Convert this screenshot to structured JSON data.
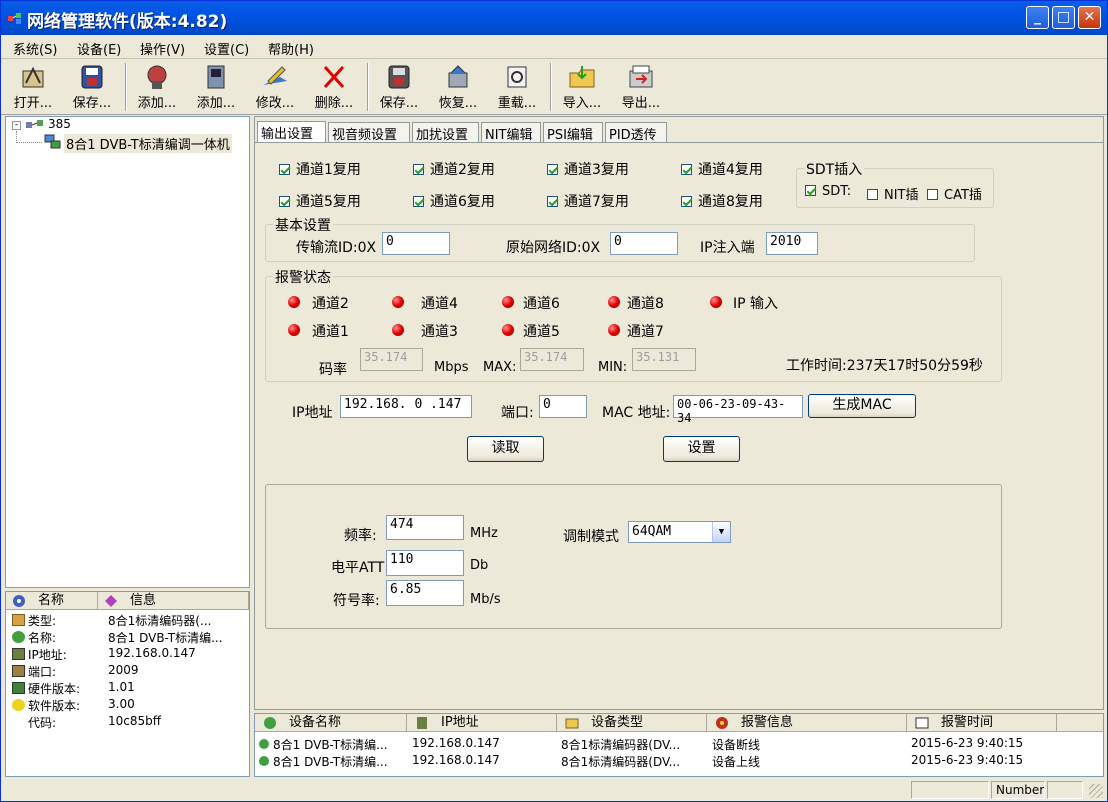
{
  "window": {
    "title": "网络管理软件(版本:4.82)"
  },
  "menu": [
    "系统(S)",
    "设备(E)",
    "操作(V)",
    "设置(C)",
    "帮助(H)"
  ],
  "toolbar": {
    "open": "打开...",
    "save": "保存...",
    "add1": "添加...",
    "add2": "添加...",
    "modify": "修改...",
    "delete": "删除...",
    "save2": "保存...",
    "restore": "恢复...",
    "reload": "重载...",
    "import": "导入...",
    "export": "导出..."
  },
  "tree": {
    "root": "385",
    "child": "8合1 DVB-T标清编调一体机"
  },
  "info": {
    "col_name": "名称",
    "col_info": "信息",
    "rows": [
      {
        "k": "类型:",
        "v": "8合1标清编码器(..."
      },
      {
        "k": "名称:",
        "v": "8合1 DVB-T标清编..."
      },
      {
        "k": "IP地址:",
        "v": "192.168.0.147"
      },
      {
        "k": "端口:",
        "v": "2009"
      },
      {
        "k": "硬件版本:",
        "v": "1.01"
      },
      {
        "k": "软件版本:",
        "v": "3.00"
      },
      {
        "k": "代码:",
        "v": "10c85bff"
      }
    ]
  },
  "tabs": [
    "输出设置",
    "视音频设置",
    "加扰设置",
    "NIT编辑",
    "PSI编辑",
    "PID透传"
  ],
  "channels": {
    "ch1": "通道1复用",
    "ch2": "通道2复用",
    "ch3": "通道3复用",
    "ch4": "通道4复用",
    "ch5": "通道5复用",
    "ch6": "通道6复用",
    "ch7": "通道7复用",
    "ch8": "通道8复用"
  },
  "sdt": {
    "title": "SDT插入",
    "sdt": "SDT:",
    "nit": "NIT插",
    "cat": "CAT插"
  },
  "basic": {
    "title": "基本设置",
    "ts_id_label": "传输流ID:0X",
    "ts_id": "0",
    "net_id_label": "原始网络ID:0X",
    "net_id": "0",
    "ip_port_label": "IP注入端",
    "ip_port": "2010"
  },
  "alarm": {
    "title": "报警状态",
    "ch2": "通道2",
    "ch4": "通道4",
    "ch6": "通道6",
    "ch8": "通道8",
    "ip": "IP 输入",
    "ch1": "通道1",
    "ch3": "通道3",
    "ch5": "通道5",
    "ch7": "通道7",
    "rate_label": "码率",
    "rate": "35.174",
    "mbps": "Mbps",
    "max_label": "MAX:",
    "max": "35.174",
    "min_label": "MIN:",
    "min": "35.131",
    "work_time": "工作时间:237天17时50分59秒"
  },
  "network": {
    "ip_label": "IP地址",
    "ip": "192.168. 0 .147",
    "port_label": "端口:",
    "port": "0",
    "mac_label": "MAC 地址:",
    "mac": "00-06-23-09-43-34",
    "gen_mac": "生成MAC"
  },
  "actions": {
    "read": "读取",
    "set": "设置"
  },
  "rf": {
    "freq_label": "频率:",
    "freq": "474",
    "freq_unit": "MHz",
    "mod_label": "调制模式",
    "mod": "64QAM",
    "att_label": "电平ATT",
    "att": "110",
    "att_unit": "Db",
    "sym_label": "符号率:",
    "sym": "6.85",
    "sym_unit": "Mb/s"
  },
  "alarmlist": {
    "cols": [
      "设备名称",
      "IP地址",
      "设备类型",
      "报警信息",
      "报警时间"
    ],
    "rows": [
      {
        "name": "8合1 DVB-T标清编...",
        "ip": "192.168.0.147",
        "type": "8合1标清编码器(DV...",
        "msg": "设备断线",
        "time": "2015-6-23 9:40:15"
      },
      {
        "name": "8合1 DVB-T标清编...",
        "ip": "192.168.0.147",
        "type": "8合1标清编码器(DV...",
        "msg": "设备上线",
        "time": "2015-6-23 9:40:15"
      }
    ]
  },
  "status": {
    "number": "Number"
  }
}
